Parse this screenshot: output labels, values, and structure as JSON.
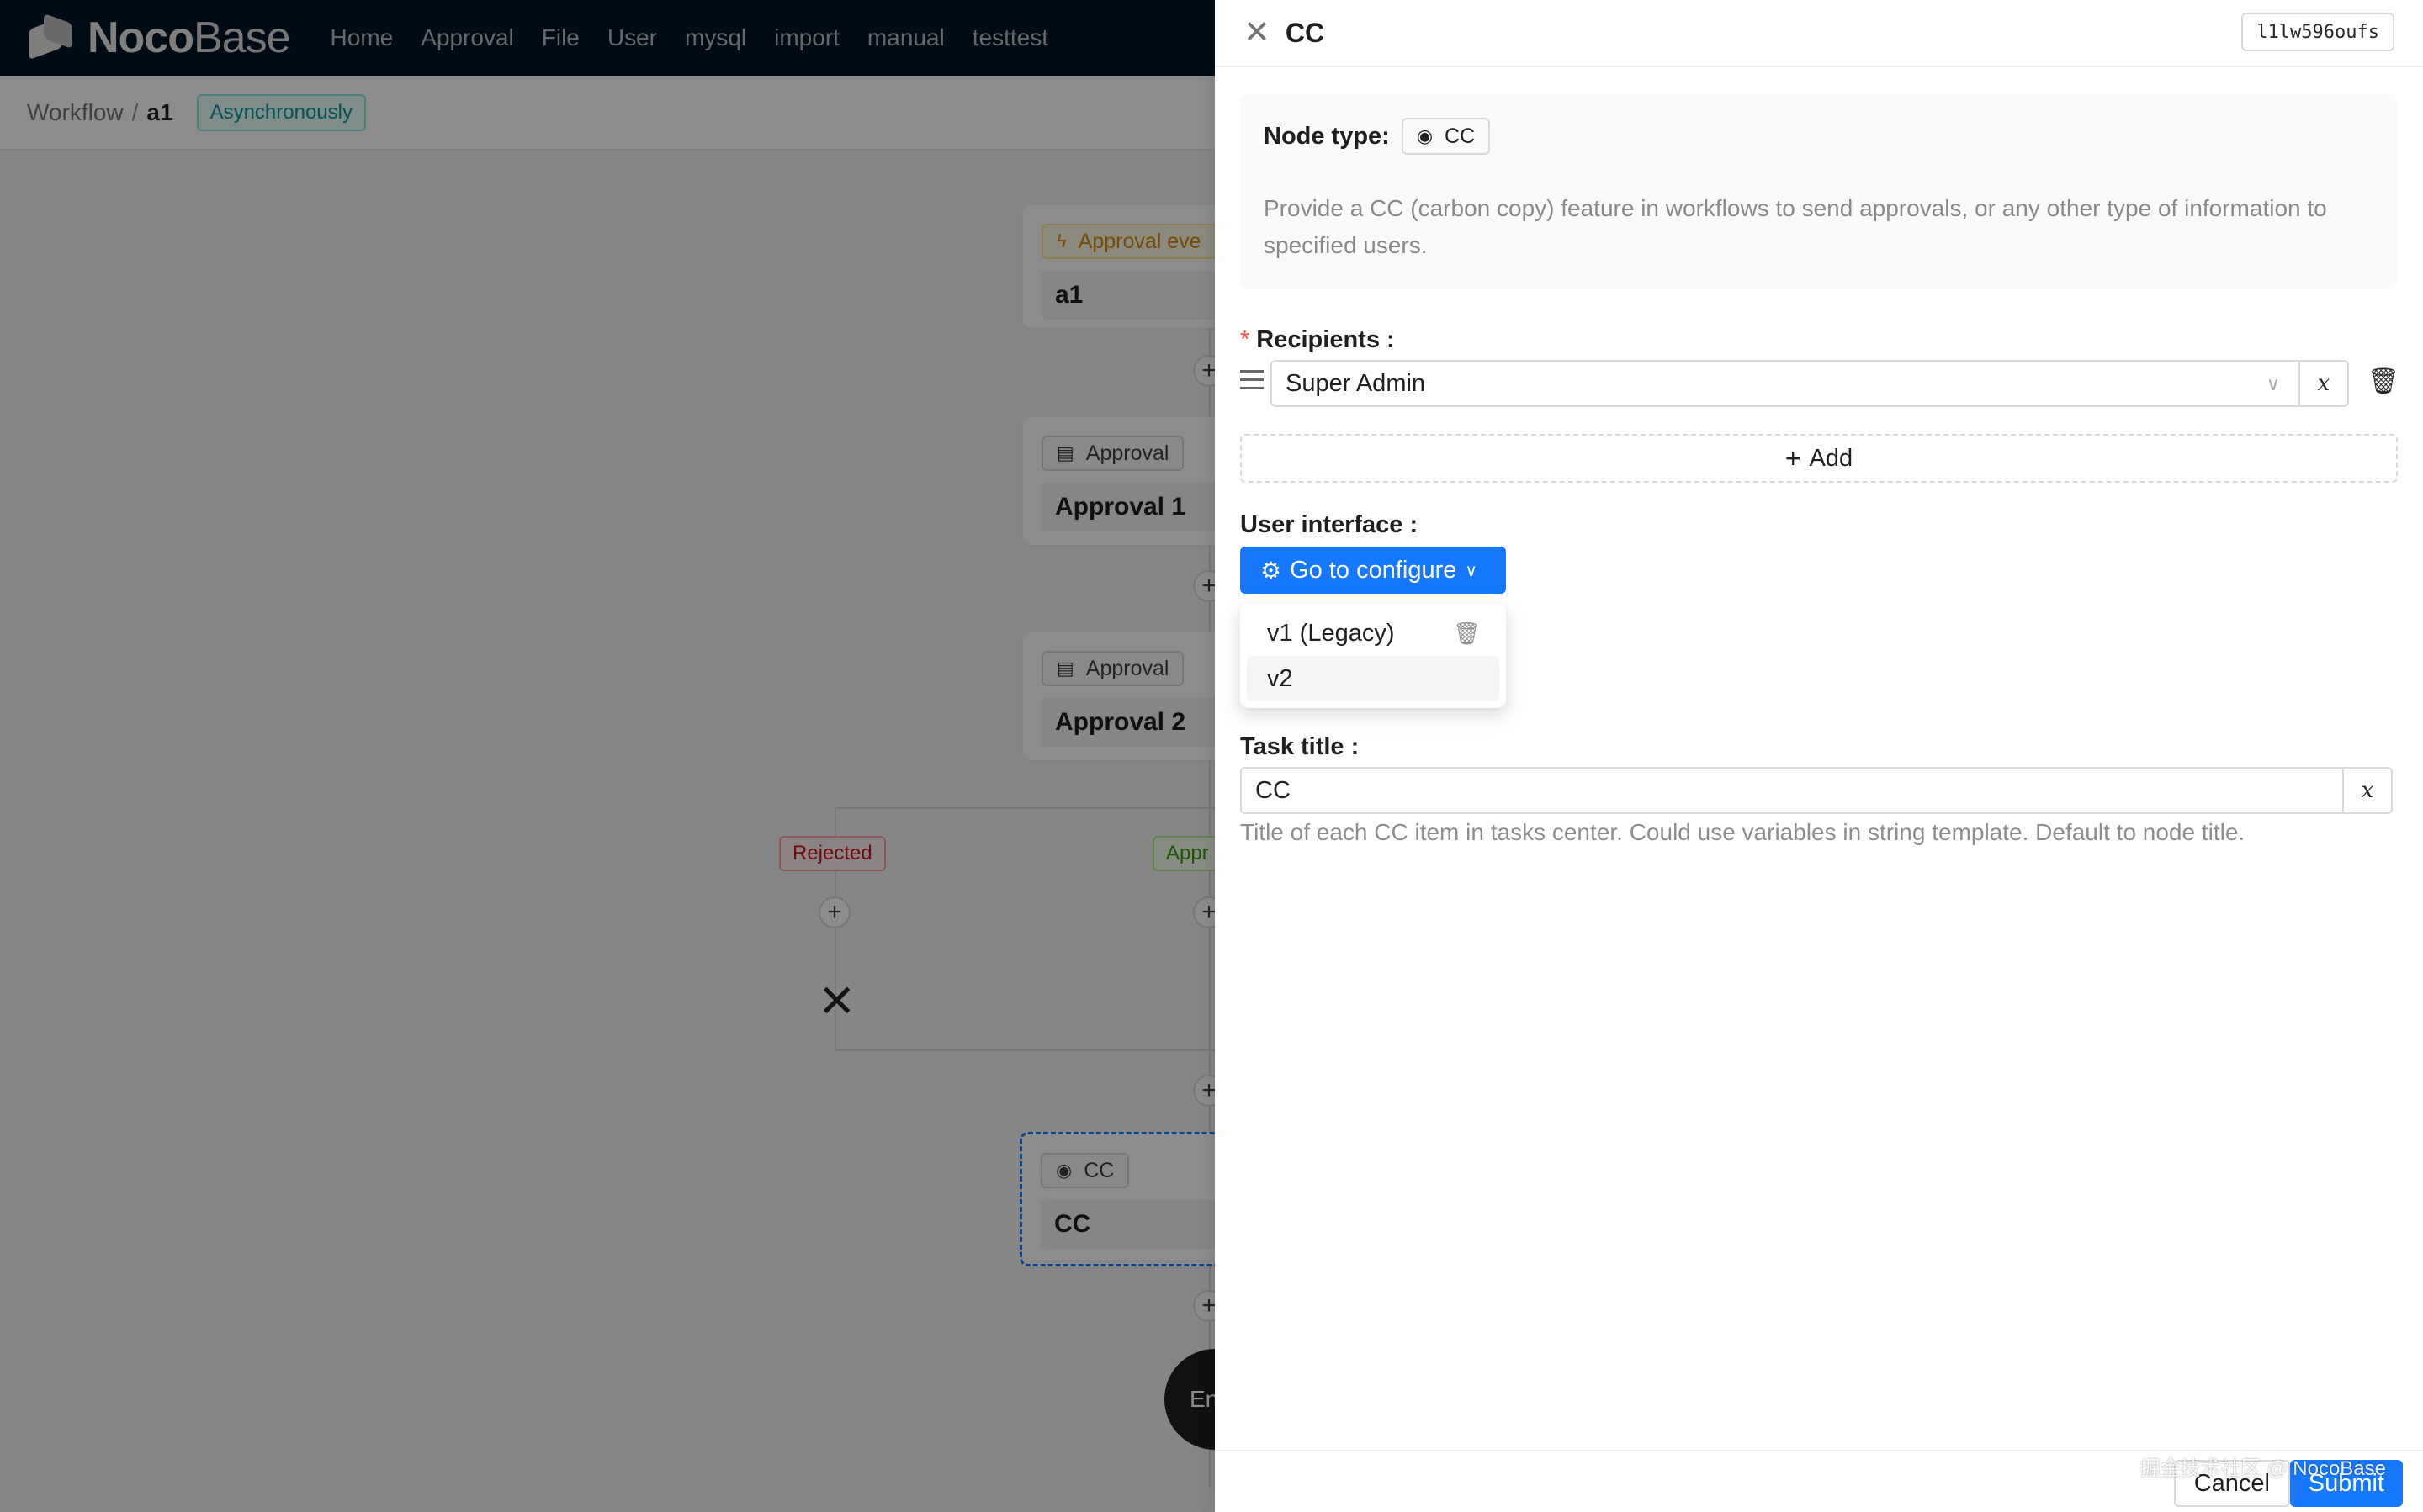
{
  "app": {
    "logo_bold": "Noco",
    "logo_light": "Base",
    "nav": [
      "Home",
      "Approval",
      "File",
      "User",
      "mysql",
      "import",
      "manual",
      "testtest"
    ]
  },
  "breadcrumb": {
    "root": "Workflow",
    "separator": "/",
    "current": "a1",
    "mode_tag": "Asynchronously"
  },
  "canvas": {
    "trigger_tag": "Approval eve",
    "trigger_title": "a1",
    "approval1_tag": "Approval",
    "approval1_title": "Approval 1",
    "approval2_tag": "Approval",
    "approval2_title": "Approval 2",
    "branch_rejected": "Rejected",
    "branch_approved": "Appr",
    "cc_tag": "CC",
    "cc_title": "CC",
    "end_label": "En"
  },
  "drawer": {
    "title": "CC",
    "node_key": "l1lw596oufs",
    "node_type_label": "Node type:",
    "node_type_value": "CC",
    "description": "Provide a CC (carbon copy) feature in workflows to send approvals, or any other type of information to specified users.",
    "recipients_label": "Recipients",
    "recipients_value": "Super Admin",
    "var_symbol": "x",
    "add_label": "Add",
    "ui_label": "User interface",
    "configure_label": "Go to configure",
    "configure_options": [
      "v1 (Legacy)",
      "v2"
    ],
    "task_title_label": "Task title",
    "task_title_value": "CC",
    "task_title_help": "Title of each CC item in tasks center. Could use variables in string template. Default to node title.",
    "cancel_label": "Cancel",
    "submit_label": "Submit",
    "watermark": "掘金技术社区 @ NocoBase"
  },
  "colors": {
    "primary": "#1677ff",
    "topbar": "#001529",
    "required": "#ff4d4f"
  }
}
